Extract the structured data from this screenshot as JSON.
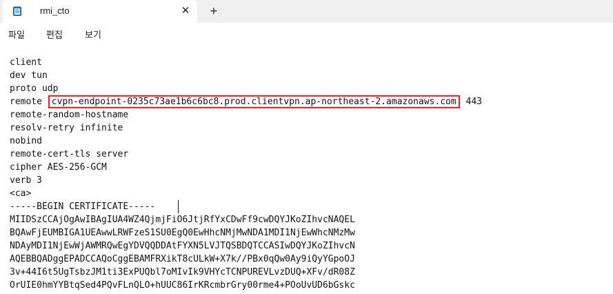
{
  "tab": {
    "title": "rmi_cto",
    "close_glyph": "✕",
    "new_tab_glyph": "+",
    "icon": "notepad-icon"
  },
  "menu": {
    "items": [
      "파일",
      "편집",
      "보기"
    ]
  },
  "editor": {
    "lines": [
      "client",
      "dev tun",
      "proto udp",
      "remote ",
      "remote-random-hostname",
      "resolv-retry infinite",
      "nobind",
      "remote-cert-tls server",
      "cipher AES-256-GCM",
      "verb 3",
      "<ca>",
      "-----BEGIN CERTIFICATE-----",
      "MIIDSzCCAjOgAwIBAgIUA4WZ4QjmjFiO6JtjRfYxCDwFf9cwDQYJKoZIhvcNAQEL",
      "BQAwFjEUMBIGA1UEAwwLRWFzeS1SU0EgQ0EwHhcNMjMwNDA1MDI1NjEwWhcNMzMw",
      "NDAyMDI1NjEwWjAWMRQwEgYDVQQDDAtFYXN5LVJTQSBDQTCCASIwDQYJKoZIhvcN",
      "AQEBBQADggEPADCCAQoCggEBAMFRXikT8cULkW+X7k//PBx0qQw0Ay9iQyYGpoOJ",
      "3v+44I6t5UgTsbzJM1ti3ExPUQbl7oMIvIk9VHYcTCNPUREVLvzDUQ+XFv/dR08Z",
      "OrUIE0hmYYBtqSed4PQvFLnQLO+hUUC86IrKRcmbrGry00rme4+POoUvUD6bGskc"
    ],
    "remote_host": "cvpn-endpoint-0235c73ae1b6c6bc8.prod.clientvpn.ap-northeast-2.amazonaws.com",
    "remote_port": "443"
  },
  "colors": {
    "highlight_border": "#e0212b",
    "titlebar": "#f0f0f0"
  }
}
